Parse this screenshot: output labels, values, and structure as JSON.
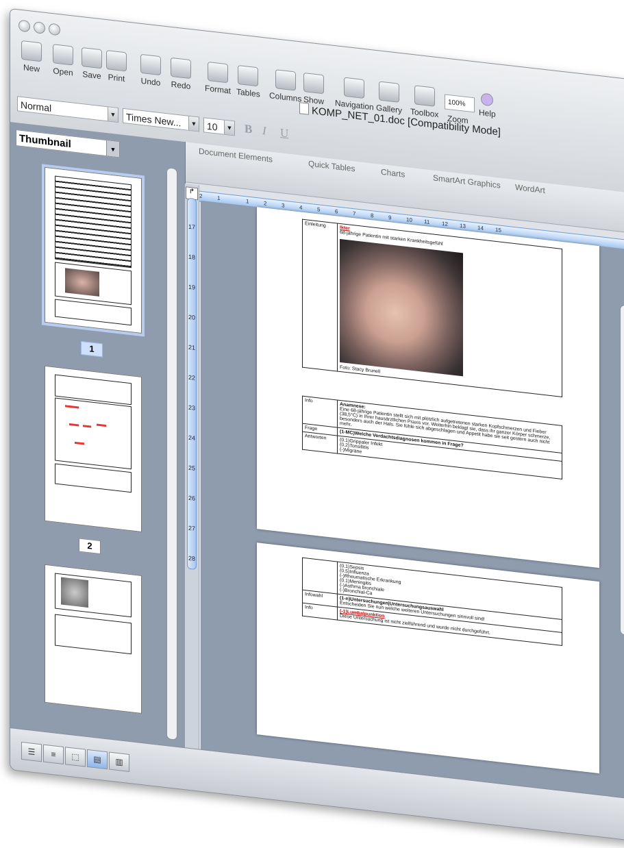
{
  "window": {
    "title": "KOMP_NET_01.doc [Compatibility Mode]"
  },
  "toolbar": {
    "new": "New",
    "open": "Open",
    "save": "Save",
    "print": "Print",
    "undo": "Undo",
    "redo": "Redo",
    "format": "Format",
    "tables": "Tables",
    "columns": "Columns",
    "show": "Show",
    "navigation": "Navigation",
    "gallery": "Gallery",
    "toolbox": "Toolbox",
    "zoom": "Zoom",
    "help": "Help",
    "zoom_value": "100%"
  },
  "formatting": {
    "style": "Normal",
    "font": "Times New...",
    "size": "10",
    "bold": "B",
    "italic": "I",
    "underline": "U"
  },
  "ribbon_tabs": [
    "Document Elements",
    "Quick Tables",
    "Charts",
    "SmartArt Graphics",
    "WordArt"
  ],
  "sidebar": {
    "view": "Thumbnail",
    "pages": [
      "1",
      "2"
    ]
  },
  "ruler": {
    "ticks": [
      "2",
      "1",
      "1",
      "2",
      "3",
      "4",
      "5",
      "6",
      "7",
      "8",
      "9",
      "10",
      "11",
      "12",
      "13",
      "14",
      "15"
    ]
  },
  "vruler": {
    "ticks": [
      "17",
      "18",
      "19",
      "20",
      "21",
      "22",
      "23",
      "24",
      "25",
      "26",
      "27",
      "28"
    ]
  },
  "page1": {
    "einleitung_label": "Einleitung",
    "einleitung_title": "Ikter",
    "einleitung_sub": "68-jährige Patientin mit starken Krankheitsgefühl",
    "photo_credit": "Foto: Stacy Brunell",
    "info_label": "Info",
    "info_title": "Anamnese:",
    "info_text": "Eine 68-jährige Patientin stellt sich mit plötzlich aufgetretenen starken Kopfschmerzen und Fieber (38,5°C) in Ihrer hausärztlichen Praxis vor. Weiterhin beklagt sie, dass ihr ganzer Körper schmerze, besonders auch der Hals. Sie fühle sich abgeschlagen und Appetit habe sie seit gestern auch nicht mehr.",
    "frage_label": "Frage",
    "frage_text": "(1-MC)Welche Verdachtsdiagnosen kommen in Frage?",
    "antworten_label": "Antworten",
    "answers": [
      "(0.1)Grippaler Infekt",
      "(0.2)Tonsillitis",
      "(-)Migräne"
    ]
  },
  "page2": {
    "answers": [
      "(0.1)Sepsis",
      "(0.5)Influenza",
      "(-)Rheumatische Erkrankung",
      "(0.1)Meningitis",
      "(-)Asthma bronchiale",
      "(-)Bronchial-Ca"
    ],
    "infowahl_label": "Infowahl",
    "infowahl_title": "(1-n)Untersuchungen|Untersuchungsauswahl",
    "infowahl_text": "Entscheiden Sie nun welche weiteren Untersuchungen sinnvoll sind!",
    "info_label": "Info",
    "info_title": "(-1)Lumbalpunktion",
    "info_text": "Diese Untersuchung ist nicht zielführend und wurde nicht durchgeführt."
  }
}
